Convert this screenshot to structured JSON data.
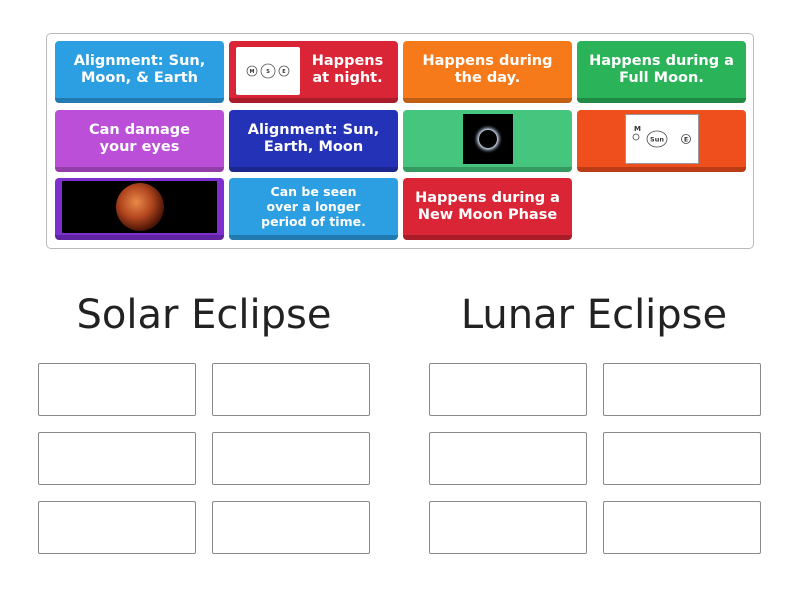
{
  "bank": {
    "tiles": [
      {
        "label": "Alignment: Sun, Moon, & Earth"
      },
      {
        "label": "Happens at night.",
        "diagram": {
          "left": "M",
          "mid": "S",
          "right": "E"
        }
      },
      {
        "label": "Happens during the day."
      },
      {
        "label": "Happens during a Full Moon."
      },
      {
        "label": "Can damage your eyes"
      },
      {
        "label": "Alignment: Sun, Earth, Moon"
      },
      {
        "label": "",
        "image": "solar-eclipse-image"
      },
      {
        "label": "",
        "diagram": {
          "left": "M",
          "mid": "Sun",
          "right": "E"
        }
      },
      {
        "label": "",
        "image": "lunar-eclipse-image"
      },
      {
        "label": "Can be seen over a longer period of time."
      },
      {
        "label": "Happens during a New Moon Phase"
      }
    ]
  },
  "groups": [
    {
      "title": "Solar Eclipse"
    },
    {
      "title": "Lunar Eclipse"
    }
  ],
  "colors": {
    "blue": "#2c9ee2",
    "red": "#d92536",
    "orange": "#f77a1a",
    "green": "#2bb35a",
    "purple": "#bb4fd8",
    "navy": "#2432b7",
    "light_green": "#45c57e",
    "orange_red": "#ef4e1d",
    "violet": "#7d2fd0"
  }
}
